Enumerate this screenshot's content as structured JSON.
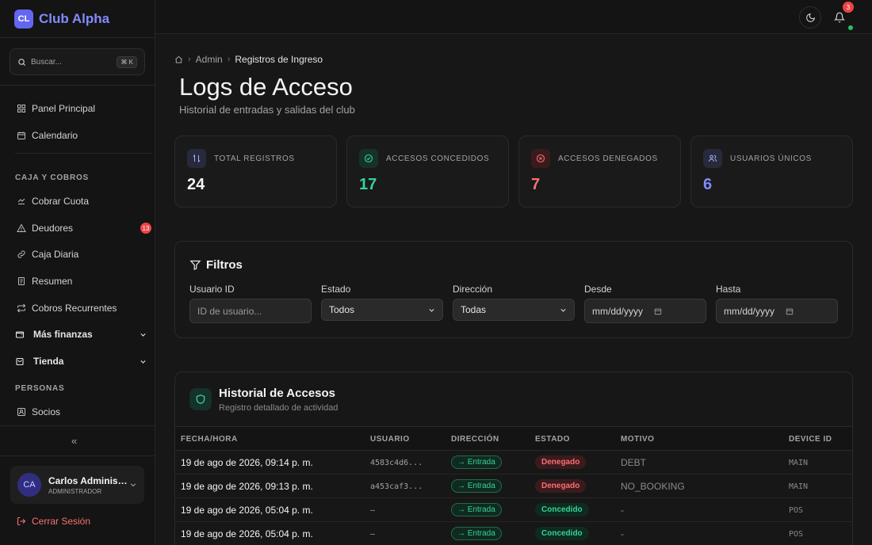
{
  "brand": {
    "logo": "CL",
    "name": "Club Alpha"
  },
  "search": {
    "placeholder": "Buscar...",
    "shortcut": "⌘ K"
  },
  "sidebar": {
    "top_items": [
      {
        "label": "Panel Principal",
        "icon": "layout-grid-icon"
      },
      {
        "label": "Calendario",
        "icon": "calendar-icon"
      }
    ],
    "section_caja": "CAJA Y COBROS",
    "caja_items": [
      {
        "label": "Cobrar Cuota",
        "icon": "coins-icon"
      },
      {
        "label": "Deudores",
        "icon": "alert-triangle-icon",
        "badge": "13"
      },
      {
        "label": "Caja Diaria",
        "icon": "link-icon"
      },
      {
        "label": "Resumen",
        "icon": "receipt-icon"
      },
      {
        "label": "Cobros Recurrentes",
        "icon": "repeat-icon"
      }
    ],
    "groups": [
      {
        "label": "Más finanzas",
        "icon": "wallet-icon"
      },
      {
        "label": "Tienda",
        "icon": "shopping-bag-icon"
      }
    ],
    "section_personas": "PERSONAS",
    "personas_items": [
      {
        "label": "Socios",
        "icon": "id-card-icon"
      }
    ],
    "collapse_label": "«"
  },
  "user": {
    "initials": "CA",
    "name": "Carlos Administrador",
    "role": "ADMINISTRADOR"
  },
  "logout_label": "Cerrar Sesión",
  "topbar": {
    "notifications_count": "3"
  },
  "breadcrumb": {
    "section": "Admin",
    "current": "Registros de Ingreso"
  },
  "page": {
    "title": "Logs de Acceso",
    "subtitle": "Historial de entradas y salidas del club"
  },
  "stats": [
    {
      "label": "TOTAL REGISTROS",
      "value": "24",
      "color": "#f5f5f5"
    },
    {
      "label": "ACCESOS CONCEDIDOS",
      "value": "17",
      "color": "#34d399"
    },
    {
      "label": "ACCESOS DENEGADOS",
      "value": "7",
      "color": "#f87171"
    },
    {
      "label": "USUARIOS ÚNICOS",
      "value": "6",
      "color": "#818cf8"
    }
  ],
  "filters": {
    "title": "Filtros",
    "user_label": "Usuario ID",
    "user_placeholder": "ID de usuario...",
    "state_label": "Estado",
    "state_value": "Todos",
    "direction_label": "Dirección",
    "direction_value": "Todas",
    "from_label": "Desde",
    "from_value": "mm/dd/yyyy",
    "to_label": "Hasta",
    "to_value": "mm/dd/yyyy"
  },
  "history": {
    "title": "Historial de Accesos",
    "subtitle": "Registro detallado de actividad",
    "columns": [
      "FECHA/HORA",
      "USUARIO",
      "DIRECCIÓN",
      "ESTADO",
      "MOTIVO",
      "DEVICE ID"
    ],
    "rows": [
      {
        "date": "19 de ago de 2026, 09:14 p. m.",
        "user": "4583c4d6...",
        "direction": "→ Entrada",
        "state": "Denegado",
        "reason": "DEBT",
        "device": "MAIN"
      },
      {
        "date": "19 de ago de 2026, 09:13 p. m.",
        "user": "a453caf3...",
        "direction": "→ Entrada",
        "state": "Denegado",
        "reason": "NO_BOOKING",
        "device": "MAIN"
      },
      {
        "date": "19 de ago de 2026, 05:04 p. m.",
        "user": "–",
        "direction": "→ Entrada",
        "state": "Concedido",
        "reason": "-",
        "device": "POS"
      },
      {
        "date": "19 de ago de 2026, 05:04 p. m.",
        "user": "–",
        "direction": "→ Entrada",
        "state": "Concedido",
        "reason": "-",
        "device": "POS"
      }
    ]
  },
  "colors": {
    "accent": "#6366f1",
    "granted": "#34d399",
    "denied": "#f87171",
    "unique": "#818cf8"
  }
}
